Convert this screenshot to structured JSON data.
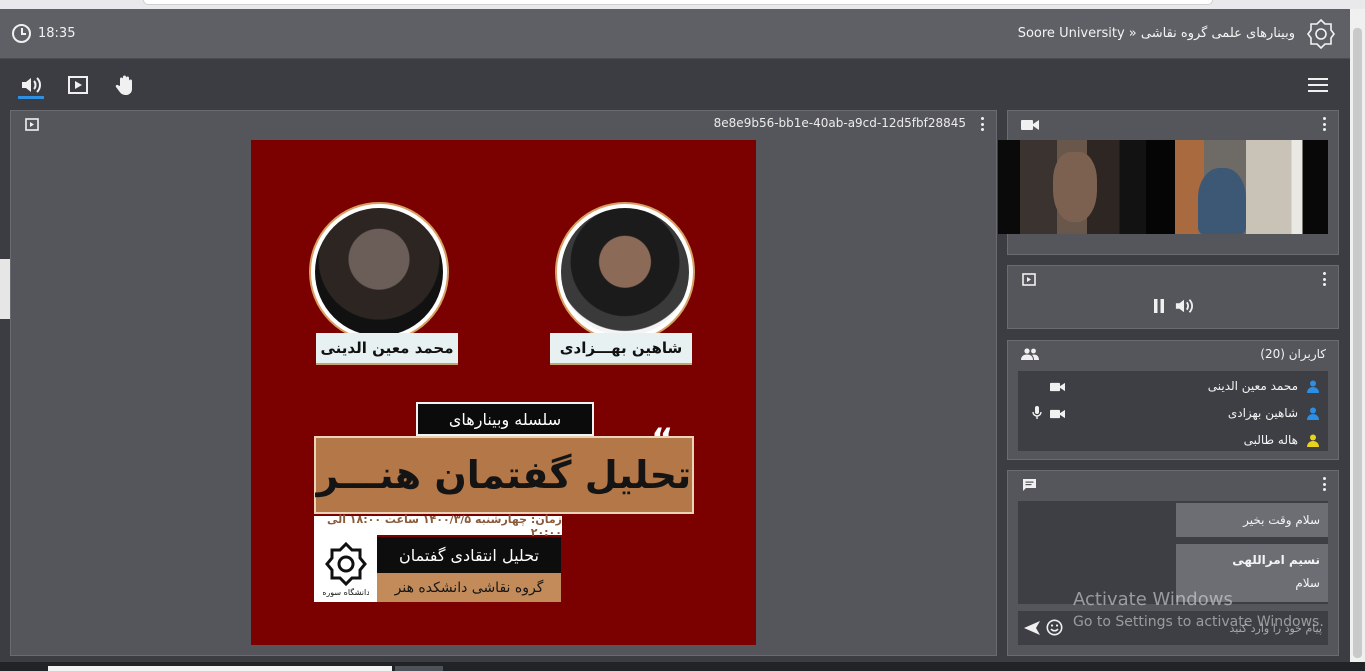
{
  "header": {
    "time": "18:35",
    "title": "Soore University » وبینارهای علمی گروه نقاشی"
  },
  "toolbar": {
    "items": [
      "speaker-icon",
      "presentation-icon",
      "raise-hand-icon"
    ],
    "active": "speaker-icon"
  },
  "presentation": {
    "document_id": "8e8e9b56-bb1e-40ab-a9cd-12d5fbf28845",
    "poster": {
      "speaker_left": "محمد معین الدینی",
      "speaker_right": "شاهین بهـــزادی",
      "series_label": "سلسله وبینارهای",
      "main_title": "تحلیل گفتمان هنـــر",
      "date_line": "زمان: چهارشنبه ۱۴۰۰/۳/۵ ساعت ۱۸:۰۰ الی ۲۰:۰۰",
      "subtitle": "تحلیل انتقادی گفتمان",
      "group": "گروه نقاشی دانشکده هنر",
      "seal_caption": "دانشگاه سوره"
    }
  },
  "users": {
    "title": "کاربران (20)",
    "list": [
      {
        "name": "محمد معین الدینی",
        "status_color": "#2b8fe6",
        "camera": true,
        "mic": false
      },
      {
        "name": "شاهین بهزادی",
        "status_color": "#2b8fe6",
        "camera": true,
        "mic": true
      },
      {
        "name": "هاله طالبی",
        "status_color": "#e8d21c",
        "camera": false,
        "mic": false
      }
    ]
  },
  "chat": {
    "messages": [
      {
        "sender": "",
        "text": "سلام وقت بخیر"
      },
      {
        "sender": "نسیم امراللهی",
        "text": "سلام"
      }
    ],
    "input_placeholder": "پیام خود را وارد کنید"
  },
  "watermark": {
    "line1": "Activate Windows",
    "line2": "Go to Settings to activate Windows."
  },
  "colors": {
    "accent": "#2f8fe0",
    "poster_background": "#7b0000",
    "panel": "#55565b",
    "header": "#5f6065"
  }
}
